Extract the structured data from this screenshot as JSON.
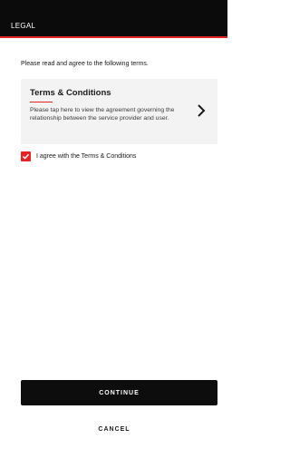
{
  "header": {
    "title": "LEGAL"
  },
  "intro": {
    "text": "Please read and agree to the following terms."
  },
  "terms_card": {
    "title": "Terms & Conditions",
    "description": "Please tap here to view the agreement governing the relationship between the service provider and user.",
    "icon": "chevron-right-icon"
  },
  "agreement": {
    "checked": true,
    "label": "I agree with the Terms & Conditions"
  },
  "actions": {
    "continue_label": "CONTINUE",
    "cancel_label": "CANCEL"
  },
  "colors": {
    "accent": "#e52323",
    "header_bg": "#0b0b0b",
    "card_bg": "#f3f3f3",
    "button_bg": "#0d0d0d"
  }
}
